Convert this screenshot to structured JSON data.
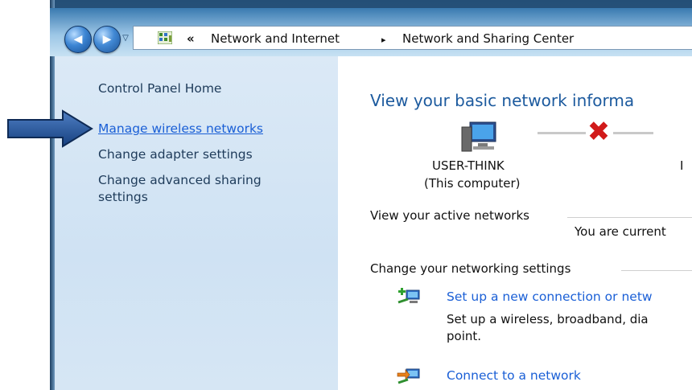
{
  "breadcrumb": {
    "overflow_glyph": "«",
    "separator_glyph": "▸",
    "items": [
      "Network and Internet",
      "Network and Sharing Center"
    ]
  },
  "nav": {
    "back_glyph": "◀",
    "forward_glyph": "▶",
    "history_glyph": "▽"
  },
  "sidebar": {
    "items": [
      {
        "label": "Control Panel Home"
      },
      {
        "label": "Manage wireless networks"
      },
      {
        "label": "Change adapter settings"
      },
      {
        "label": "Change advanced sharing settings"
      }
    ]
  },
  "main": {
    "headline": "View your basic network informa",
    "computer_name": "USER-THINK",
    "computer_sub": "(This computer)",
    "internet_fragment": "I",
    "active_networks_title": "View your active networks",
    "active_networks_status": "You are current",
    "change_settings_title": "Change your networking settings",
    "tasks": [
      {
        "label": "Set up a new connection or netw",
        "description_line1": "Set up a wireless, broadband, dia",
        "description_line2": "point."
      },
      {
        "label": "Connect to a network"
      }
    ]
  },
  "colors": {
    "link": "#1a5fd6",
    "headline": "#1c5a9e",
    "pointer": "#1b4f9c",
    "error_x": "#d11a1a"
  },
  "icons": {
    "back": "back-arrow-icon",
    "forward": "forward-arrow-icon",
    "control_panel": "control-panel-icon",
    "computer": "computer-icon",
    "disconnected": "disconnected-x-icon",
    "new_connection": "new-connection-icon",
    "connect_network": "connect-network-icon",
    "pointer": "pointer-arrow-icon"
  }
}
